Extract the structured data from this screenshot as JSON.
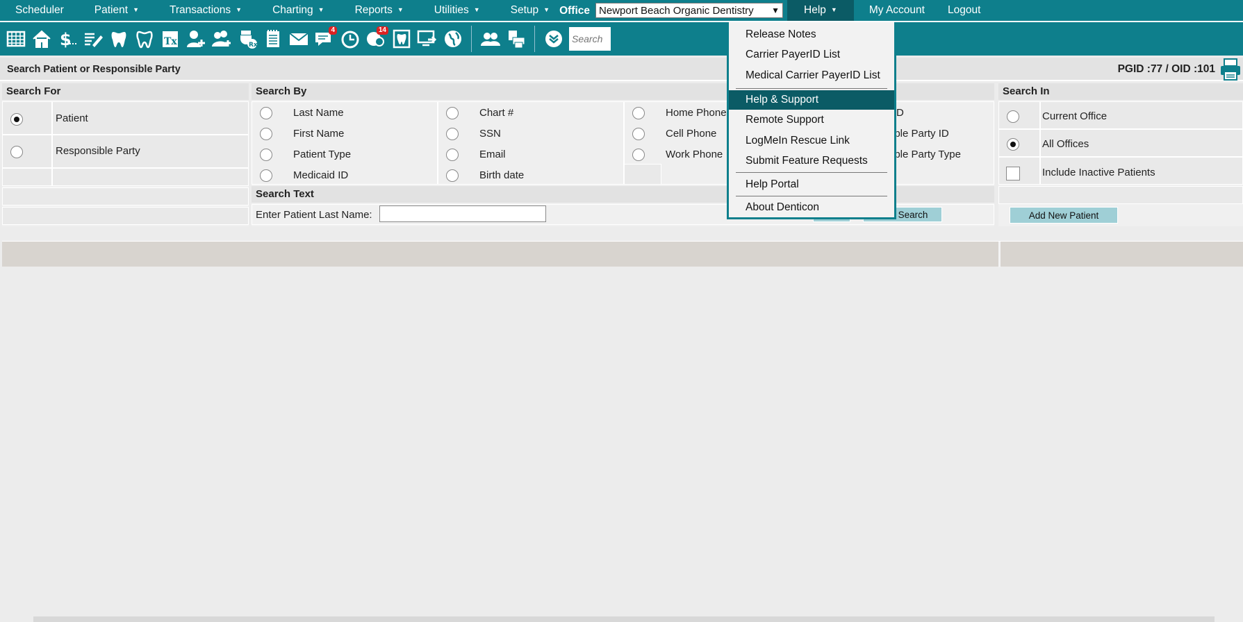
{
  "nav": {
    "scheduler": "Scheduler",
    "patient": "Patient",
    "transactions": "Transactions",
    "charting": "Charting",
    "reports": "Reports",
    "utilities": "Utilities",
    "setup": "Setup",
    "office_label": "Office",
    "office_value": "Newport Beach Organic Dentistry",
    "help": "Help",
    "my_account": "My Account",
    "logout": "Logout"
  },
  "toolbar": {
    "messages_badge": "4",
    "patients_badge": "14",
    "search_placeholder": "Search"
  },
  "titlebar": {
    "title": "Search Patient or Responsible Party",
    "pgid": "PGID :77  /  OID :101"
  },
  "search_for": {
    "heading": "Search For",
    "options": [
      "Patient",
      "Responsible Party"
    ],
    "selected": "Patient"
  },
  "search_by": {
    "heading": "Search By",
    "col1": [
      "Last Name",
      "First Name",
      "Patient Type",
      "Medicaid ID"
    ],
    "col2": [
      "Chart #",
      "SSN",
      "Email",
      "Birth date"
    ],
    "col3": [
      "Home Phone",
      "Cell Phone",
      "Work Phone"
    ],
    "col4_partial": [
      "D",
      "ible Party ID",
      "ible Party Type"
    ]
  },
  "search_text": {
    "heading": "Search Text",
    "label": "Enter Patient Last Name:",
    "value": "",
    "search_button": "Search"
  },
  "search_in": {
    "heading": "Search In",
    "options": [
      "Current Office",
      "All Offices"
    ],
    "selected": "All Offices",
    "include_inactive": "Include Inactive Patients",
    "add_new_patient": "Add New Patient"
  },
  "help_menu": {
    "items": [
      "Release Notes",
      "Carrier PayerID List",
      "Medical Carrier PayerID List",
      "Help & Support",
      "Remote Support",
      "LogMeIn Rescue Link",
      "Submit Feature Requests",
      "Help Portal",
      "About Denticon"
    ],
    "highlighted": "Help & Support"
  }
}
